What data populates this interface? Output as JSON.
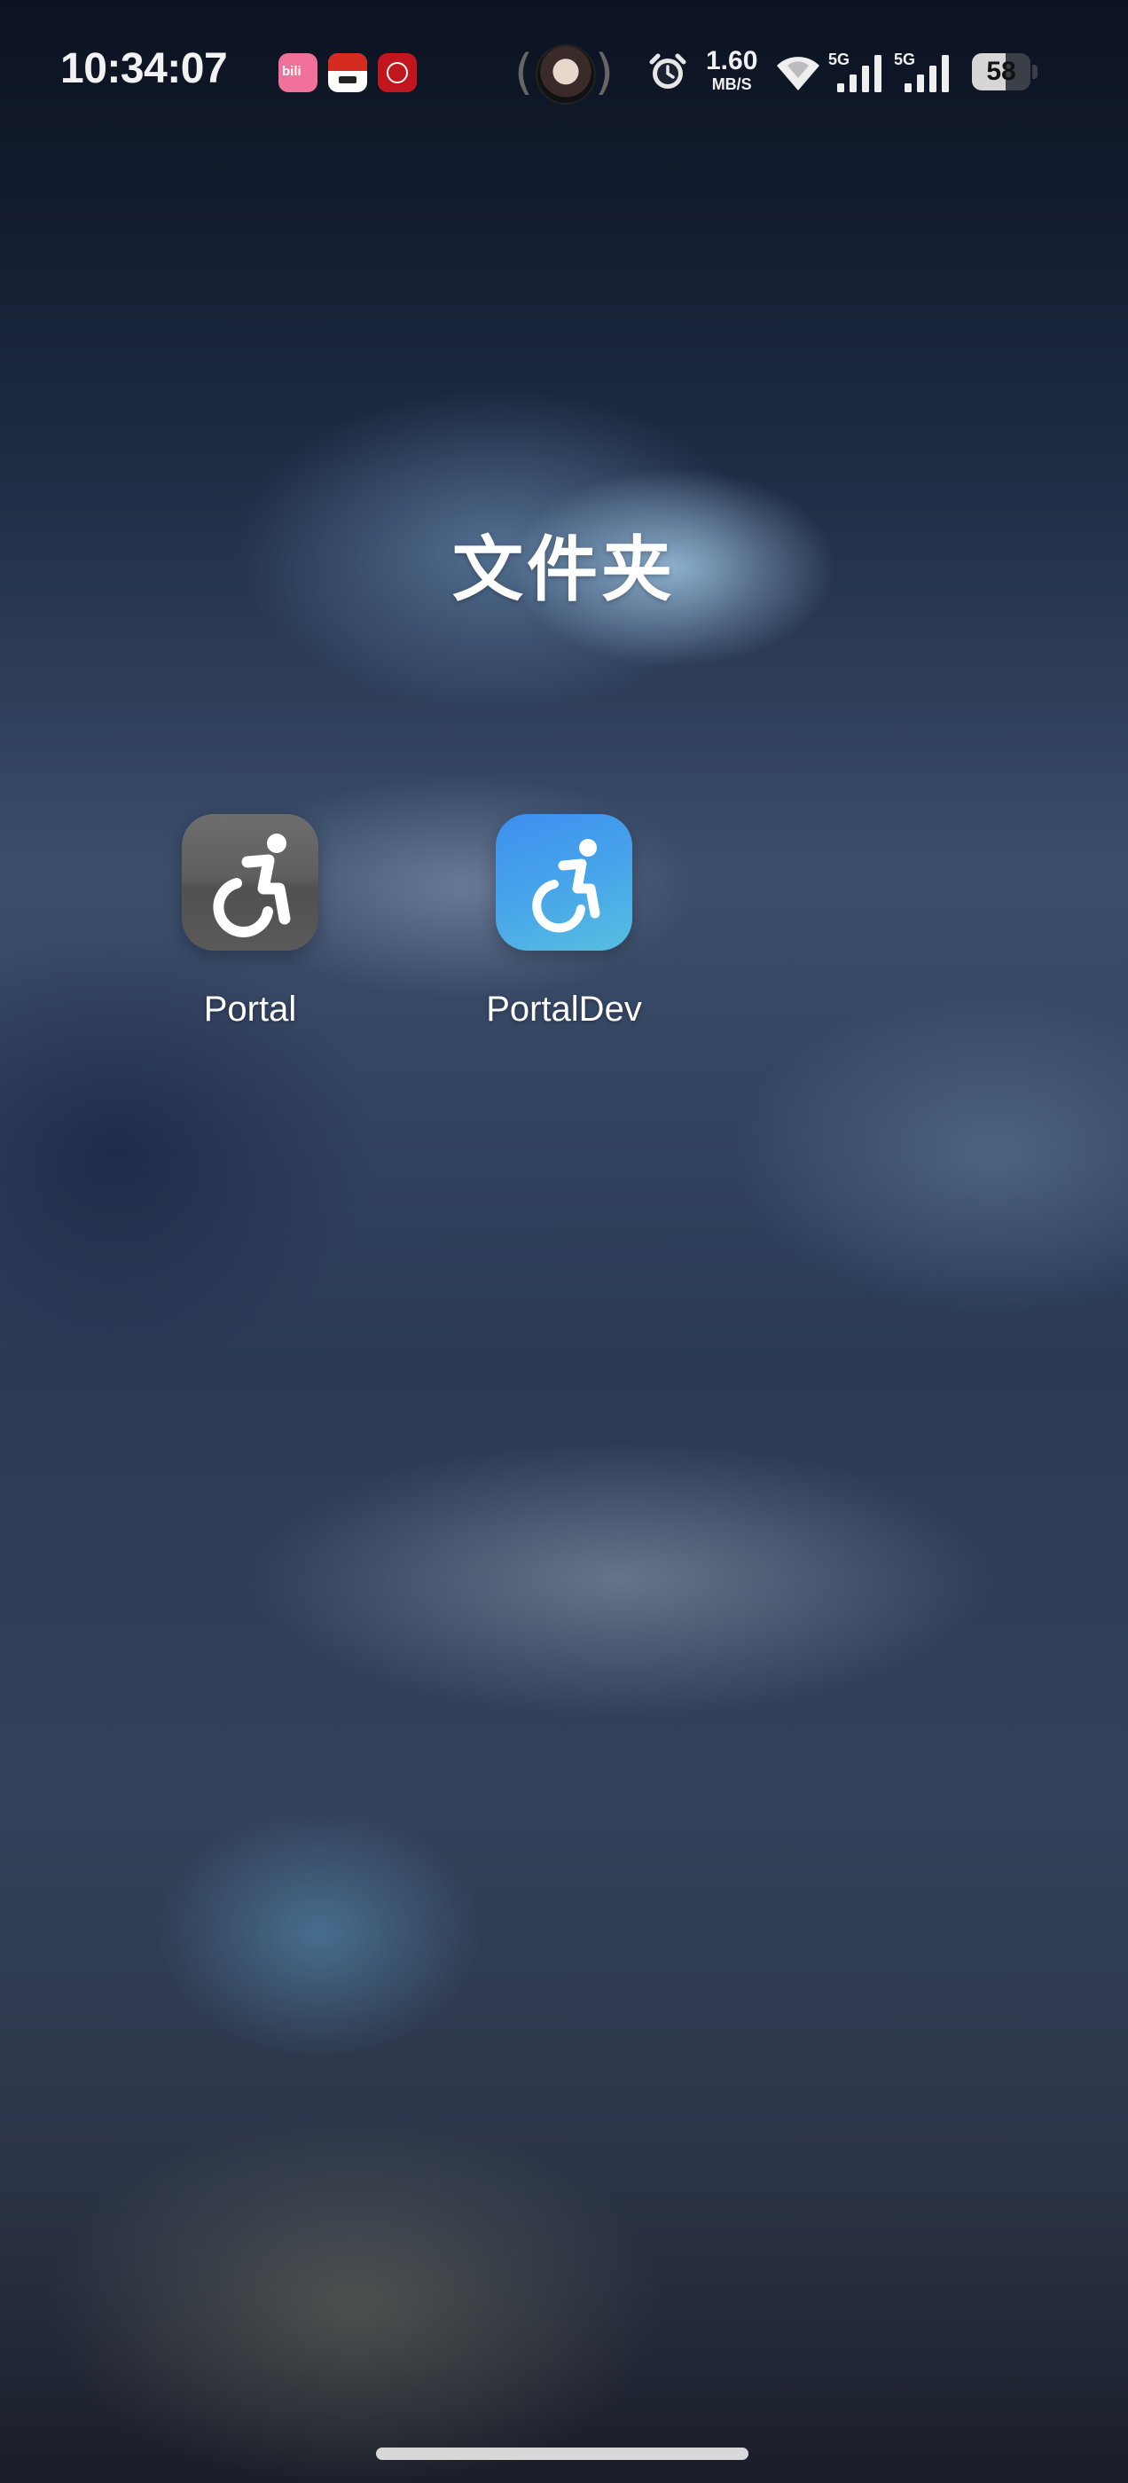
{
  "status_bar": {
    "time": "10:34:07",
    "notification_icons": [
      "bilibili-icon",
      "payment-app-icon",
      "bank-app-icon"
    ],
    "network_speed_value": "1.60",
    "network_speed_unit": "MB/S",
    "signal_1_label": "5G",
    "signal_2_label": "5G",
    "battery_percent": "58",
    "battery_level": 0.58
  },
  "folder": {
    "title": "文件夹",
    "apps": [
      {
        "label": "Portal",
        "icon": "wheelchair-icon",
        "color": "#5f5f5f"
      },
      {
        "label": "PortalDev",
        "icon": "wheelchair-icon",
        "color": "#47a4ea"
      }
    ]
  }
}
